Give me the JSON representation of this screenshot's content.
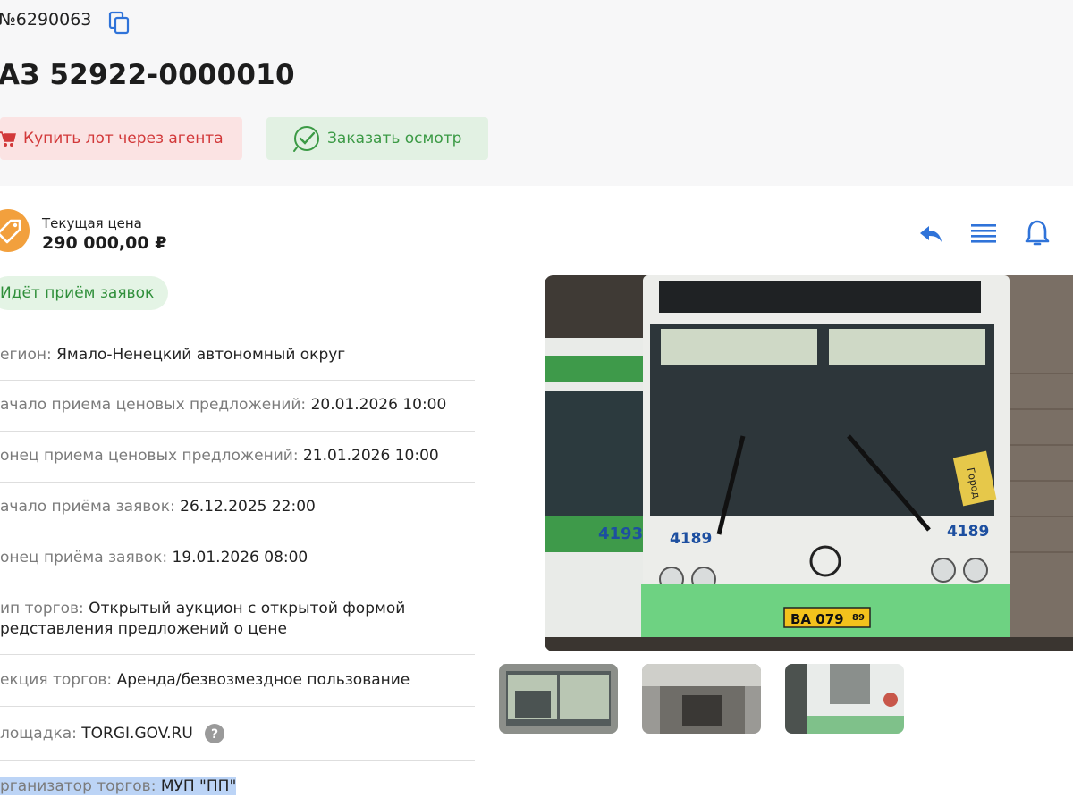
{
  "header": {
    "lot_number": "№6290063",
    "title": "АЗ 52922-0000010",
    "buy_button": "Купить лот через агента",
    "inspect_button": "Заказать осмотр"
  },
  "price": {
    "label": "Текущая цена",
    "value": "290 000,00 ₽"
  },
  "status": "Идёт приём заявок",
  "details": [
    {
      "key": "егион:",
      "value": "Ямало-Ненецкий автономный округ"
    },
    {
      "key": "ачало приема ценовых предложений:",
      "value": "20.01.2026 10:00"
    },
    {
      "key": "онец приема ценовых предложений:",
      "value": "21.01.2026 10:00"
    },
    {
      "key": "ачало приёма заявок:",
      "value": "26.12.2025 22:00"
    },
    {
      "key": "онец приёма заявок:",
      "value": "19.01.2026 08:00"
    },
    {
      "key": "ип торгов:",
      "value": "Открытый аукцион с открытой формой",
      "value2": "редставления предложений о цене"
    },
    {
      "key": "екция торгов:",
      "value": "Аренда/безвозмездное пользование"
    },
    {
      "key": "лощадка:",
      "value": "TORGI.GOV.RU"
    },
    {
      "key": "рганизатор торгов:",
      "value": "МУП \"ПП\""
    }
  ],
  "photo": {
    "bus_number": "4189",
    "side_number": "4193",
    "plate": "ВА 079",
    "plate_region": "89",
    "sign_text": "Город"
  },
  "icons": {
    "copy": "copy-icon",
    "cart": "cart-icon",
    "check": "check-circle-icon",
    "price": "price-tag-icon",
    "reply": "reply-icon",
    "menu": "list-icon",
    "bell": "bell-icon",
    "help": "help-icon"
  },
  "colors": {
    "accent_blue": "#2f73d9",
    "buy_red": "#d2393a",
    "inspect_green": "#3b9a45",
    "price_orange": "#f2a03d"
  }
}
